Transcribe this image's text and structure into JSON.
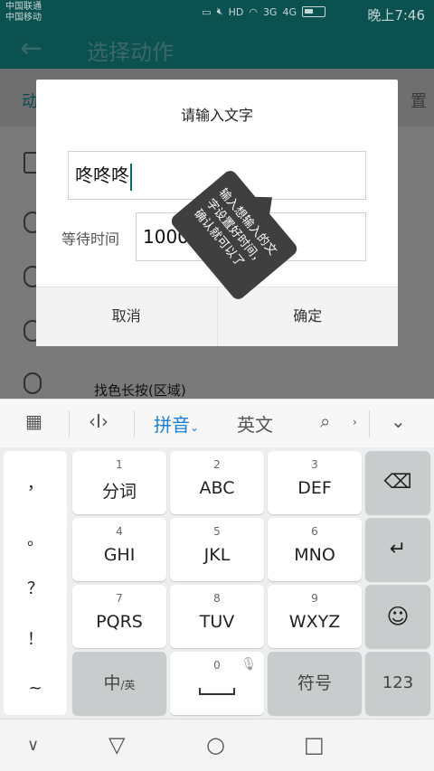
{
  "status": {
    "carrier1": "中国联通",
    "carrier2": "中国移动",
    "time": "晚上7:46",
    "net_3g": "3G",
    "net_4g": "4G",
    "hd": "HD"
  },
  "appbar": {
    "title": "选择动作"
  },
  "background": {
    "tab_left": "动",
    "tab_right": "置",
    "row_label": "找色长按(区域)"
  },
  "dialog": {
    "title": "请输入文字",
    "text_value": "咚咚咚",
    "wait_label": "等待时间",
    "wait_value": "1000",
    "cancel": "取消",
    "confirm": "确定"
  },
  "tooltip": {
    "text": "输入想输入的文字设置好时间，确认就可以了"
  },
  "keyboard": {
    "toolbar": {
      "pinyin": "拼音",
      "english": "英文"
    },
    "symbols": [
      "，",
      "。",
      "？",
      "！",
      "~"
    ],
    "keys": [
      {
        "num": "1",
        "label": "分词"
      },
      {
        "num": "2",
        "label": "ABC"
      },
      {
        "num": "3",
        "label": "DEF"
      },
      {
        "num": "4",
        "label": "GHI"
      },
      {
        "num": "5",
        "label": "JKL"
      },
      {
        "num": "6",
        "label": "MNO"
      },
      {
        "num": "7",
        "label": "PQRS"
      },
      {
        "num": "8",
        "label": "TUV"
      },
      {
        "num": "9",
        "label": "WXYZ"
      }
    ],
    "zh_key": "中",
    "zh_sub": "/英",
    "space_num": "0",
    "symbol_key": "符号",
    "num_key": "123"
  },
  "colors": {
    "primary": "#0b5150",
    "accent": "#0a6e6a",
    "keyboard_bg": "#eceeef"
  }
}
